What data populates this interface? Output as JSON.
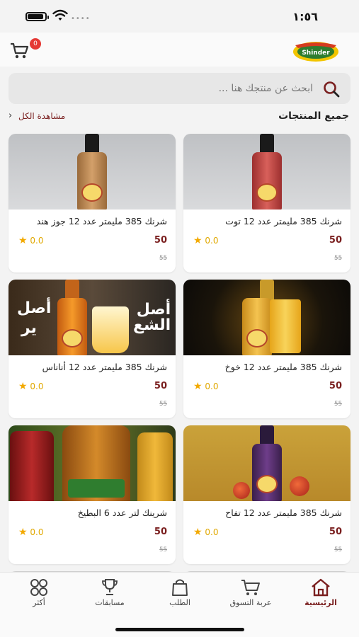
{
  "status": {
    "time": "١:٥٦"
  },
  "header": {
    "cart_count": "0",
    "logo_text": "Shinder"
  },
  "search": {
    "placeholder": "ابحث عن منتجك هنا ..."
  },
  "section": {
    "title": "جميع المنتجات",
    "see_all": "مشاهدة الكل"
  },
  "products": [
    {
      "name": "شرنك 385 مليمتر عدد 12 توت",
      "price": "50",
      "old_price": "55",
      "rating": "0.0"
    },
    {
      "name": "شرنك 385 مليمتر عدد 12 جوز هند",
      "price": "50",
      "old_price": "55",
      "rating": "0.0"
    },
    {
      "name": "شرنك 385 مليمتر عدد 12 خوخ",
      "price": "50",
      "old_price": "55",
      "rating": "0.0"
    },
    {
      "name": "شرنك 385 مليمتر عدد 12 أناناس",
      "price": "50",
      "old_price": "55",
      "rating": "0.0"
    },
    {
      "name": "شرنك 385 مليمتر عدد 12 تفاح",
      "price": "50",
      "old_price": "55",
      "rating": "0.0"
    },
    {
      "name": "شرينك لتر عدد 6 البطيخ",
      "price": "50",
      "old_price": "55",
      "rating": "0.0"
    }
  ],
  "banner_text": {
    "line1": "أصل",
    "line2": "الشع",
    "line3": "ير"
  },
  "nav": [
    {
      "label": "الرئيسية",
      "icon": "home-icon",
      "active": true
    },
    {
      "label": "عربة التسوق",
      "icon": "cart-icon"
    },
    {
      "label": "الطلب",
      "icon": "bag-icon"
    },
    {
      "label": "مسابقات",
      "icon": "trophy-icon"
    },
    {
      "label": "أكثر",
      "icon": "grid-icon"
    }
  ],
  "colors": {
    "accent": "#7a1f1f",
    "star": "#f2a900",
    "badge": "#e53935"
  }
}
